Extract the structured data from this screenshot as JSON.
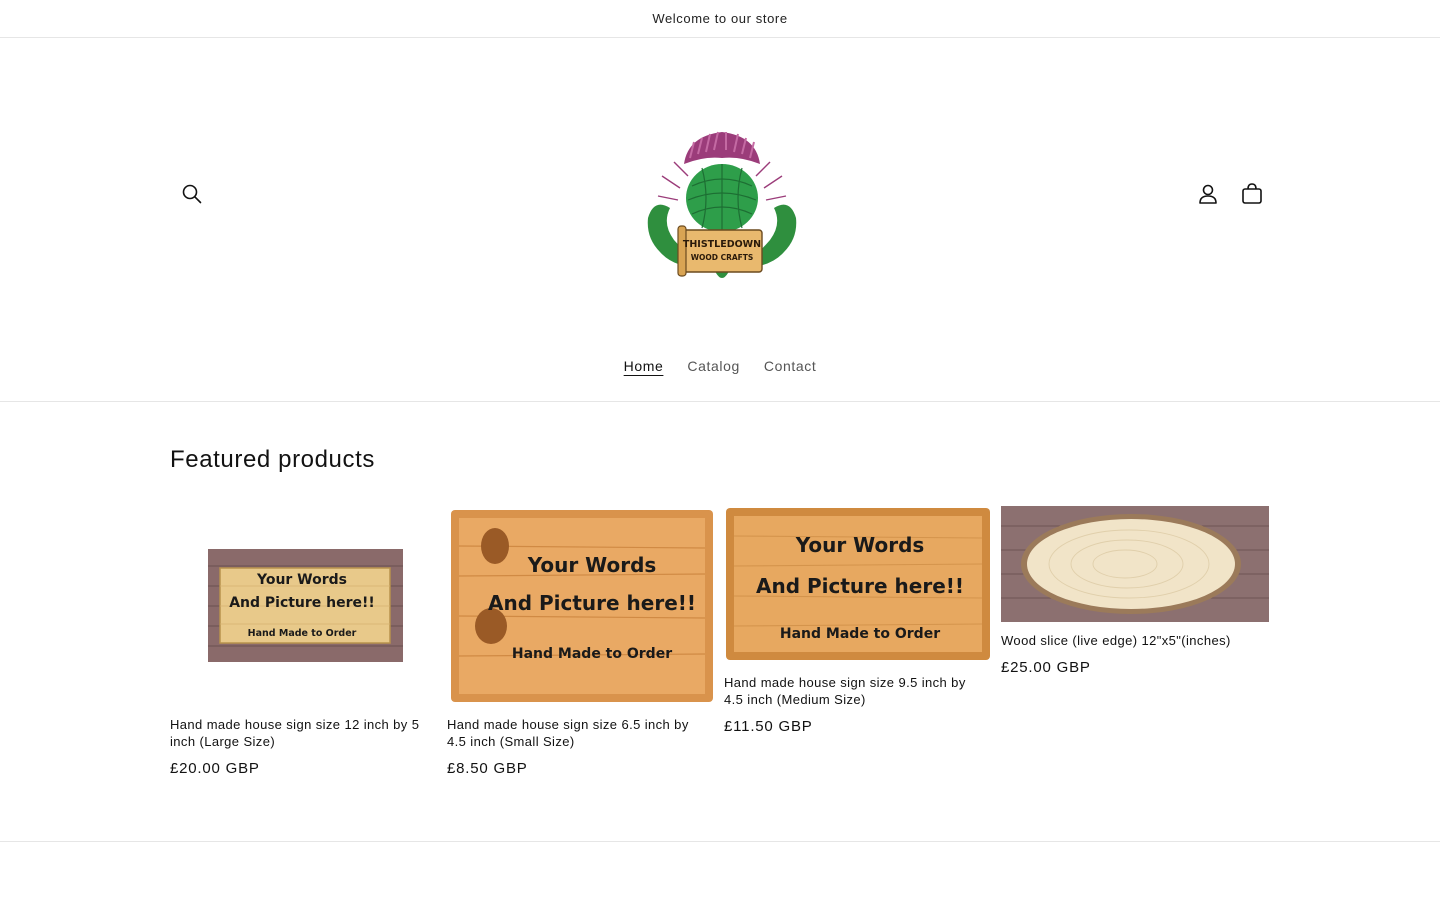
{
  "announcement": {
    "text": "Welcome to our store"
  },
  "header": {
    "logo_text_line1": "THISTLEDOWN",
    "logo_text_line2": "WOOD CRAFTS",
    "search_icon": "search-icon",
    "account_icon": "account-icon",
    "cart_icon": "cart-icon"
  },
  "nav": {
    "items": [
      {
        "label": "Home",
        "active": true
      },
      {
        "label": "Catalog",
        "active": false
      },
      {
        "label": "Contact",
        "active": false
      }
    ]
  },
  "featured": {
    "title": "Featured products",
    "products": [
      {
        "title": "Hand made house sign size 12 inch by 5 inch (Large Size)",
        "price": "£20.00 GBP",
        "image_line1": "Your Words",
        "image_line2": "And Picture here!!",
        "image_line3": "Hand Made to Order"
      },
      {
        "title": "Hand made house sign size 6.5 inch by 4.5 inch (Small Size)",
        "price": "£8.50 GBP",
        "image_line1": "Your Words",
        "image_line2": "And Picture here!!",
        "image_line3": "Hand Made to Order"
      },
      {
        "title": "Hand made house sign size 9.5 inch by 4.5 inch (Medium Size)",
        "price": "£11.50 GBP",
        "image_line1": "Your Words",
        "image_line2": "And Picture here!!",
        "image_line3": "Hand Made to Order"
      },
      {
        "title": "Wood slice (live edge) 12\"x5\"(inches)",
        "price": "£25.00 GBP"
      }
    ]
  }
}
